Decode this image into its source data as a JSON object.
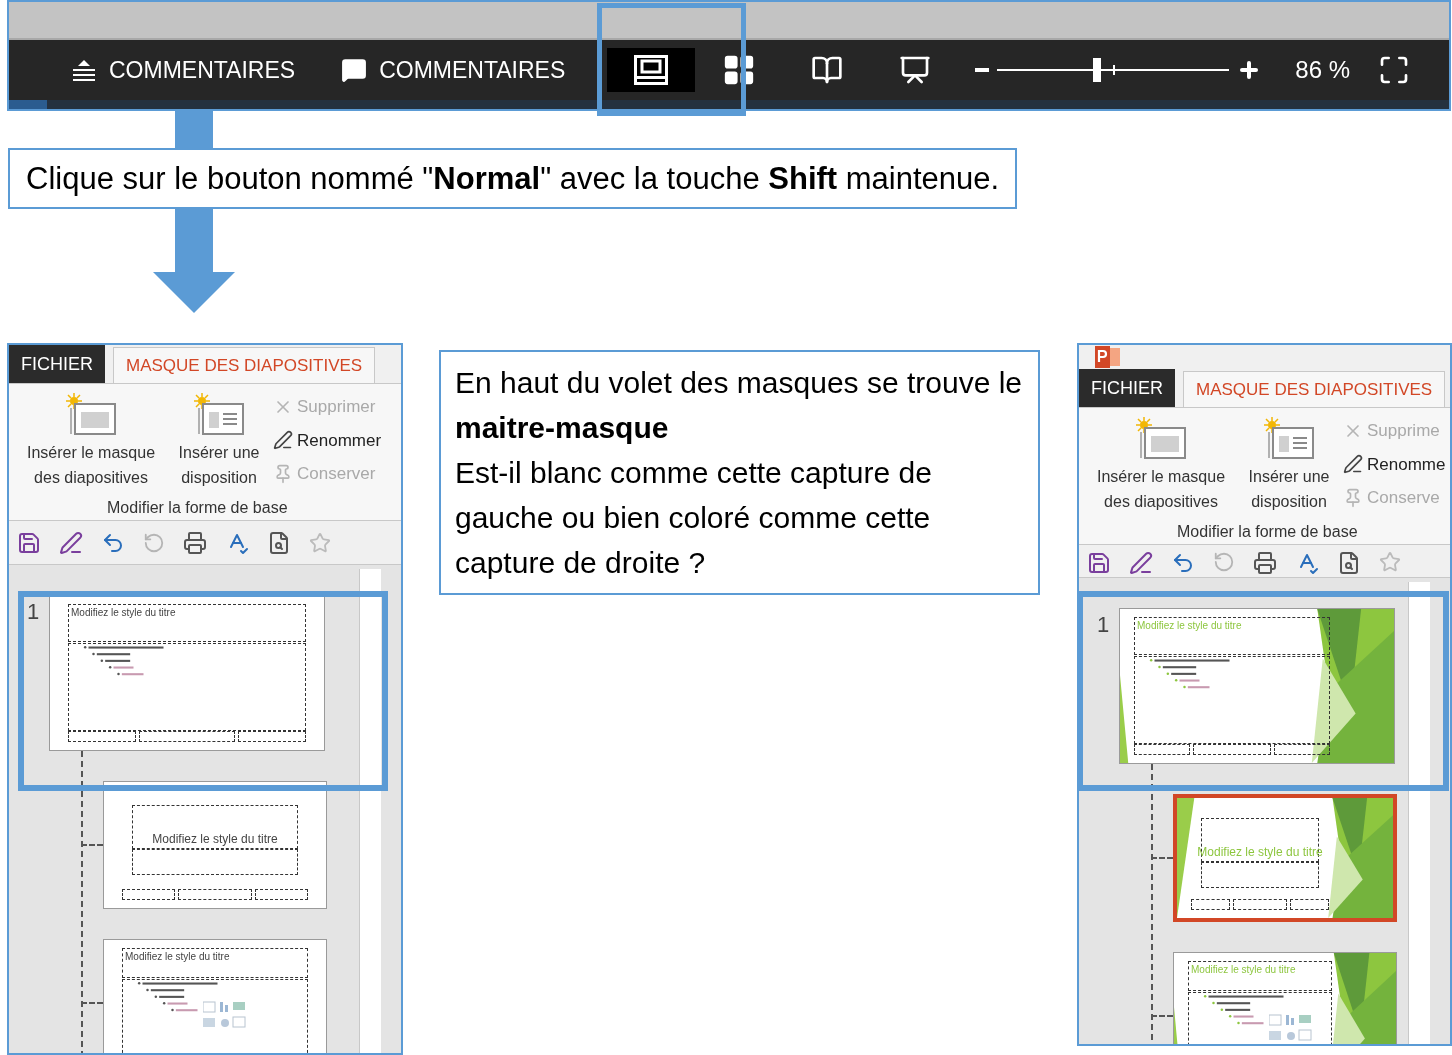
{
  "status_bar": {
    "items": [
      {
        "kind": "notes",
        "label": "COMMENTAIRES"
      },
      {
        "kind": "comments",
        "label": "COMMENTAIRES"
      },
      {
        "kind": "normal",
        "selected": true
      },
      {
        "kind": "sorter",
        "selected": false
      },
      {
        "kind": "reading",
        "selected": false
      },
      {
        "kind": "slideshow",
        "selected": false
      }
    ],
    "zoom": {
      "level": 0.43,
      "reading": "86 %"
    }
  },
  "instruction": "Clique sur le bouton nommé \"**Normal**\" avec la touche **Shift** maintenue.",
  "question": [
    "En haut du volet des masques se trouve le **maitre-masque**",
    "Est-il blanc comme cette capture de gauche ou bien coloré comme cette capture de droite ?"
  ],
  "captures": [
    {
      "kind": "plain",
      "tabs": [
        {
          "label": "FICHIER",
          "kind": "file",
          "selected": false
        },
        {
          "label": "MASQUE DES DIAPOSITIVES",
          "kind": "tab",
          "selected": true
        }
      ],
      "large_buttons": [
        {
          "label": "Insérer le masque des diapositives",
          "kind": "master"
        },
        {
          "label": "Insérer une disposition",
          "kind": "layout"
        }
      ],
      "small_buttons": [
        {
          "label": "Supprimer",
          "kind": "delete",
          "disabled": true
        },
        {
          "label": "Renommer",
          "kind": "rename",
          "disabled": false
        },
        {
          "label": "Conserver",
          "kind": "keep",
          "disabled": true
        }
      ],
      "group_label": "Modifier la forme de base",
      "slides": [
        {
          "number": "1",
          "kind": "master",
          "title": "Modifiez le style du titre",
          "selected": false,
          "children": [
            {
              "kind": "title",
              "title": "Modifiez le style du titre",
              "selected": false
            },
            {
              "kind": "content",
              "title": "Modifiez le style du titre",
              "selected": false
            }
          ]
        }
      ]
    },
    {
      "kind": "green",
      "app_icon": true,
      "tabs": [
        {
          "label": "FICHIER",
          "kind": "file",
          "selected": false
        },
        {
          "label": "MASQUE DES DIAPOSITIVES",
          "kind": "tab",
          "selected": true
        }
      ],
      "large_buttons": [
        {
          "label": "Insérer le masque des diapositives",
          "kind": "master"
        },
        {
          "label": "Insérer une disposition",
          "kind": "layout"
        }
      ],
      "small_buttons": [
        {
          "label": "Supprime",
          "kind": "delete",
          "disabled": true
        },
        {
          "label": "Renomme",
          "kind": "rename",
          "disabled": false
        },
        {
          "label": "Conserve",
          "kind": "keep",
          "disabled": true
        }
      ],
      "group_label": "Modifier la forme de base",
      "slides": [
        {
          "number": "1",
          "kind": "master",
          "title": "Modifiez le style du titre",
          "selected": false,
          "children": [
            {
              "kind": "title",
              "title": "Modifiez le style du titre",
              "selected": true
            },
            {
              "kind": "content",
              "title": "Modifiez le style du titre",
              "selected": false
            }
          ]
        }
      ]
    }
  ]
}
